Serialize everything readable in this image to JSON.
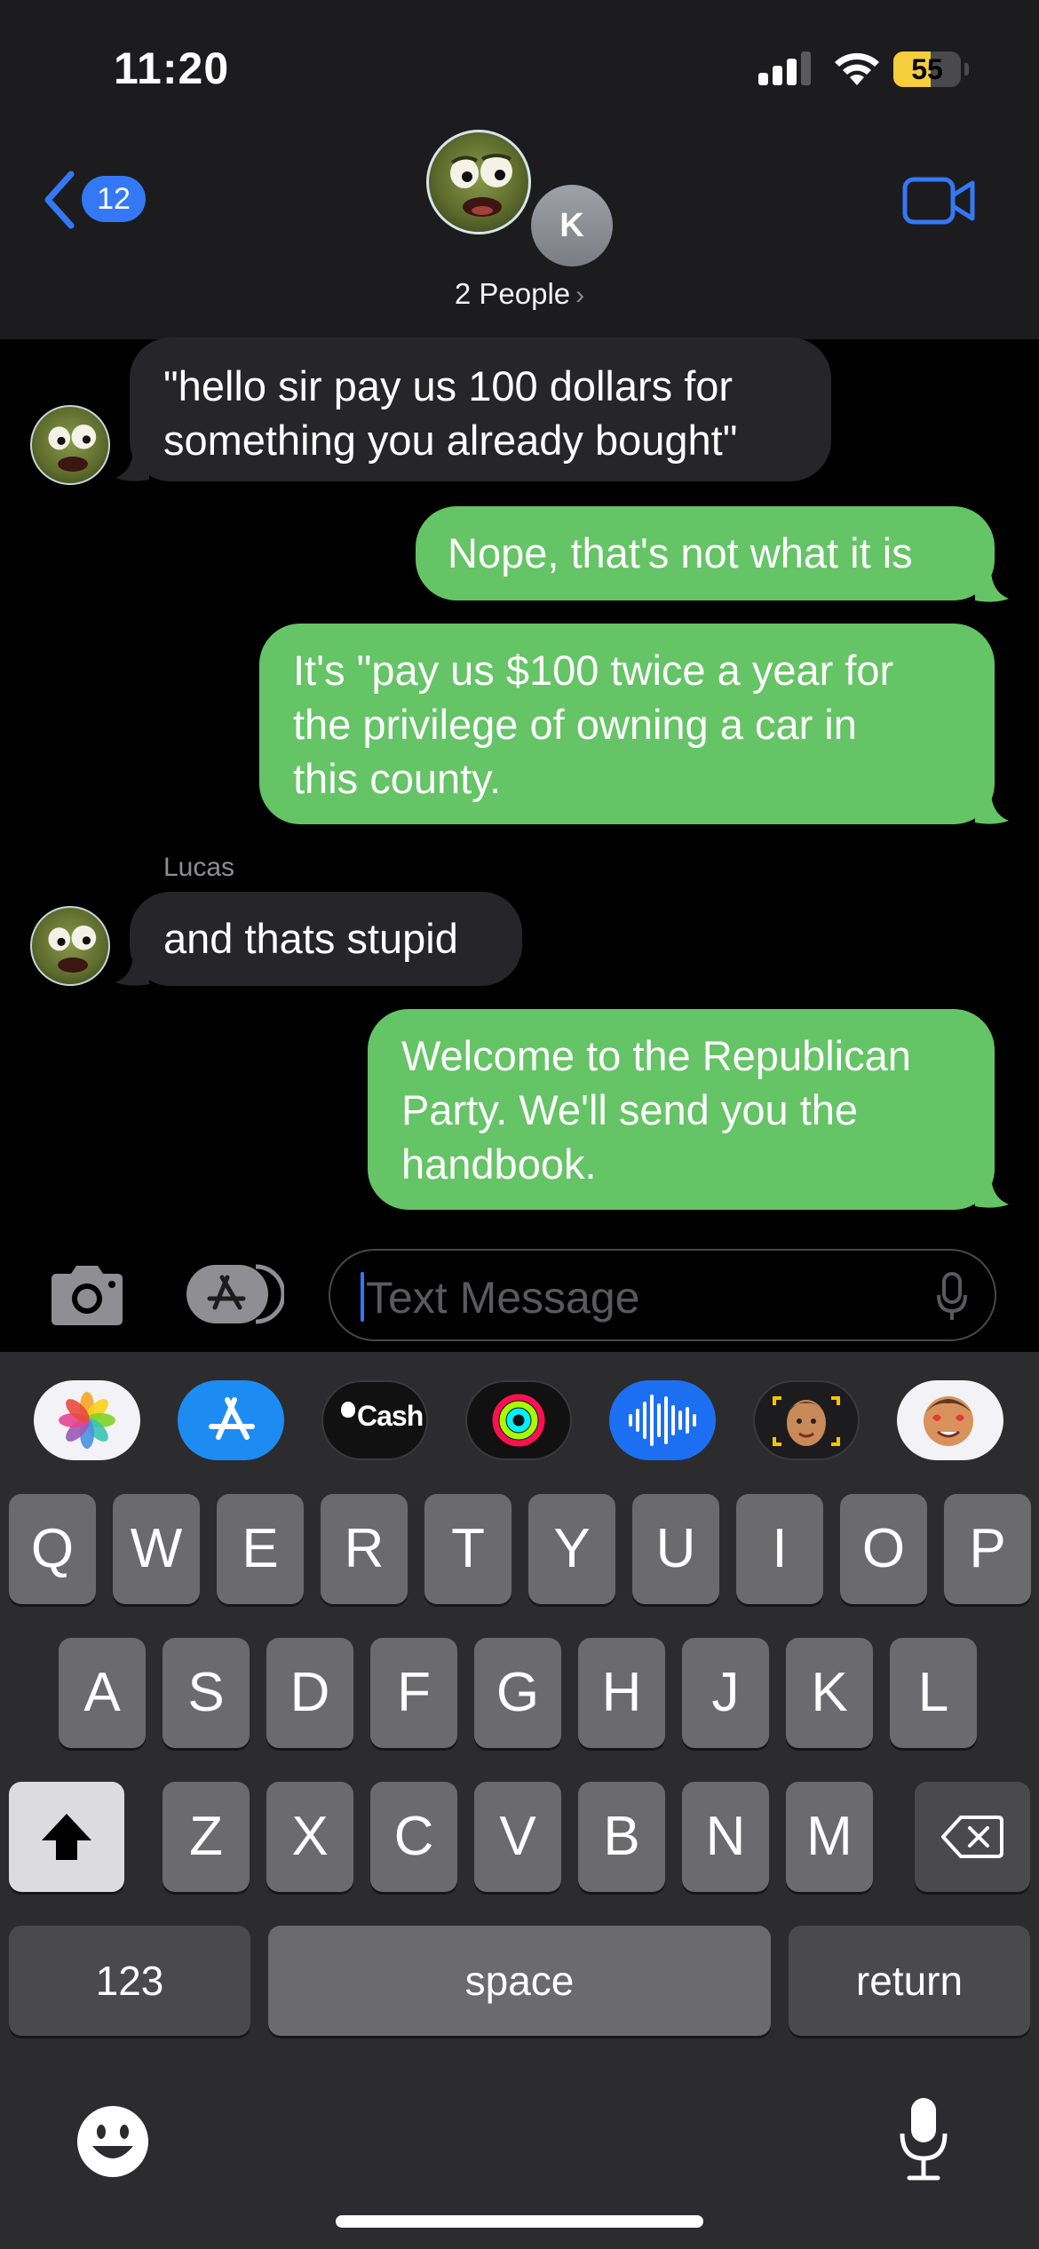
{
  "status_bar": {
    "time": "11:20",
    "battery_percent": "55",
    "battery_level": 0.55,
    "signal_bars": 3
  },
  "header": {
    "back_badge": "12",
    "contact_initial": "K",
    "people_label": "2 People",
    "people_chevron": "›",
    "icons": [
      "chevron-left-icon",
      "video-camera-icon"
    ],
    "accent_color": "#3478f6"
  },
  "messages": [
    {
      "direction": "incoming",
      "text": "\"hello sir pay us 100 dollars for something you already bought\"",
      "lines": [
        "\"hello sir pay us 100 dollars for",
        "something you already bought\""
      ]
    },
    {
      "direction": "outgoing",
      "text": "Nope, that's not what it is",
      "lines": [
        "Nope, that's not what it is"
      ]
    },
    {
      "direction": "outgoing",
      "text": "It's \"pay us $100 twice a year for the privilege of owning a car in this county.",
      "lines": [
        "It's \"pay us $100 twice a year for",
        "the privilege of owning a car in",
        "this county."
      ]
    },
    {
      "direction": "incoming",
      "sender": "Lucas",
      "text": "and thats stupid",
      "lines": [
        "and thats stupid"
      ]
    },
    {
      "direction": "outgoing",
      "text": "Welcome to the Republican Party. We'll send you the handbook.",
      "lines": [
        "Welcome to the Republican",
        "Party. We'll send you the",
        "handbook."
      ]
    }
  ],
  "bubble_colors": {
    "incoming": "#262628",
    "outgoing": "#65c466"
  },
  "composer": {
    "placeholder": "Text Message",
    "icons": [
      "camera-icon",
      "app-store-icon",
      "microphone-icon"
    ]
  },
  "app_strip": [
    {
      "name": "photos",
      "icon": "photos-icon"
    },
    {
      "name": "app-store",
      "icon": "app-store-icon"
    },
    {
      "name": "apple-cash",
      "label": "Cash",
      "icon": "apple-logo-icon"
    },
    {
      "name": "fitness",
      "icon": "activity-rings-icon"
    },
    {
      "name": "audio-message",
      "icon": "waveform-icon"
    },
    {
      "name": "memoji",
      "icon": "memoji-icon"
    },
    {
      "name": "memoji-stickers",
      "icon": "memoji-sticker-icon"
    }
  ],
  "keyboard": {
    "row1": [
      "Q",
      "W",
      "E",
      "R",
      "T",
      "Y",
      "U",
      "I",
      "O",
      "P"
    ],
    "row2": [
      "A",
      "S",
      "D",
      "F",
      "G",
      "H",
      "J",
      "K",
      "L"
    ],
    "row3": [
      "Z",
      "X",
      "C",
      "V",
      "B",
      "N",
      "M"
    ],
    "numbers_label": "123",
    "space_label": "space",
    "return_label": "return",
    "icons": [
      "shift-icon",
      "delete-icon",
      "emoji-icon",
      "dictation-mic-icon"
    ]
  }
}
